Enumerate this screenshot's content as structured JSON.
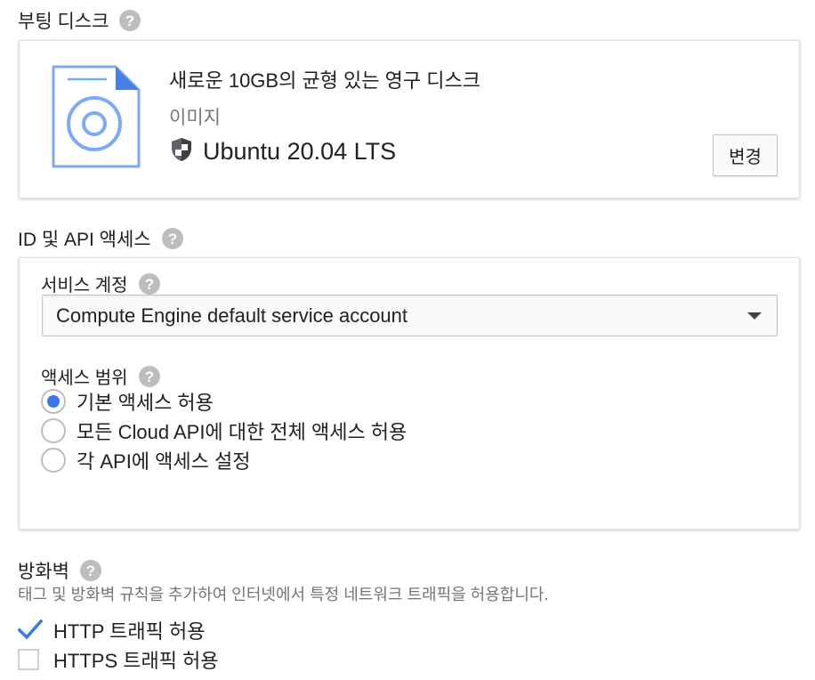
{
  "boot_disk": {
    "title": "부팅 디스크",
    "disk_title": "새로운 10GB의 균형 있는 영구 디스크",
    "image_label": "이미지",
    "os_name": "Ubuntu 20.04 LTS",
    "change_button": "변경"
  },
  "identity_api": {
    "title": "ID 및 API 액세스",
    "service_account_label": "서비스 계정",
    "service_account_value": "Compute Engine default service account",
    "access_scope_label": "액세스 범위",
    "scopes": [
      {
        "label": "기본 액세스 허용",
        "selected": true
      },
      {
        "label": "모든 Cloud API에 대한 전체 액세스 허용",
        "selected": false
      },
      {
        "label": "각 API에 액세스 설정",
        "selected": false
      }
    ]
  },
  "firewall": {
    "title": "방화벽",
    "description": "태그 및 방화벽 규칙을 추가하여 인터넷에서 특정 네트워크 트래픽을 허용합니다.",
    "options": [
      {
        "label": "HTTP 트래픽 허용",
        "checked": true
      },
      {
        "label": "HTTPS 트래픽 허용",
        "checked": false
      }
    ]
  },
  "colors": {
    "accent": "#3b78e7",
    "disk_icon": "#7baaf7",
    "help_icon": "#bdbdbd",
    "secondary_text": "#757575"
  },
  "icons": {
    "help": "help-circle-icon",
    "disk": "disk-file-icon",
    "shield": "shield-icon",
    "dropdown": "caret-down-icon",
    "check": "checkmark-icon"
  }
}
